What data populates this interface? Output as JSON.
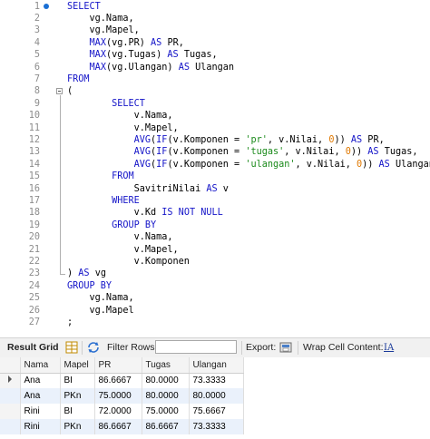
{
  "editor": {
    "lines": [
      {
        "n": "1",
        "segs": [
          [
            "kw",
            "SELECT"
          ]
        ]
      },
      {
        "n": "2",
        "segs": [
          [
            "",
            "    vg.Nama,"
          ]
        ]
      },
      {
        "n": "3",
        "segs": [
          [
            "",
            "    vg.Mapel,"
          ]
        ]
      },
      {
        "n": "4",
        "segs": [
          [
            "",
            "    "
          ],
          [
            "kw",
            "MAX"
          ],
          [
            "",
            "(vg.PR) "
          ],
          [
            "kw",
            "AS"
          ],
          [
            "",
            " PR,"
          ]
        ]
      },
      {
        "n": "5",
        "segs": [
          [
            "",
            "    "
          ],
          [
            "kw",
            "MAX"
          ],
          [
            "",
            "(vg.Tugas) "
          ],
          [
            "kw",
            "AS"
          ],
          [
            "",
            " Tugas,"
          ]
        ]
      },
      {
        "n": "6",
        "segs": [
          [
            "",
            "    "
          ],
          [
            "kw",
            "MAX"
          ],
          [
            "",
            "(vg.Ulangan) "
          ],
          [
            "kw",
            "AS"
          ],
          [
            "",
            " Ulangan"
          ]
        ]
      },
      {
        "n": "7",
        "segs": [
          [
            "kw",
            "FROM"
          ]
        ]
      },
      {
        "n": "8",
        "segs": [
          [
            "",
            "("
          ]
        ]
      },
      {
        "n": "9",
        "segs": [
          [
            "",
            "        "
          ],
          [
            "kw",
            "SELECT"
          ]
        ]
      },
      {
        "n": "10",
        "segs": [
          [
            "",
            "            v.Nama,"
          ]
        ]
      },
      {
        "n": "11",
        "segs": [
          [
            "",
            "            v.Mapel,"
          ]
        ]
      },
      {
        "n": "12",
        "segs": [
          [
            "",
            "            "
          ],
          [
            "kw",
            "AVG"
          ],
          [
            "",
            "("
          ],
          [
            "kw",
            "IF"
          ],
          [
            "",
            "(v.Komponen = "
          ],
          [
            "str",
            "'pr'"
          ],
          [
            "",
            ", v.Nilai, "
          ],
          [
            "num",
            "0"
          ],
          [
            "",
            "))"
          ],
          [
            "",
            " "
          ],
          [
            "kw",
            "AS"
          ],
          [
            "",
            " PR,"
          ]
        ]
      },
      {
        "n": "13",
        "segs": [
          [
            "",
            "            "
          ],
          [
            "kw",
            "AVG"
          ],
          [
            "",
            "("
          ],
          [
            "kw",
            "IF"
          ],
          [
            "",
            "(v.Komponen = "
          ],
          [
            "str",
            "'tugas'"
          ],
          [
            "",
            ", v.Nilai, "
          ],
          [
            "num",
            "0"
          ],
          [
            "",
            "))"
          ],
          [
            "",
            " "
          ],
          [
            "kw",
            "AS"
          ],
          [
            "",
            " Tugas,"
          ]
        ]
      },
      {
        "n": "14",
        "segs": [
          [
            "",
            "            "
          ],
          [
            "kw",
            "AVG"
          ],
          [
            "",
            "("
          ],
          [
            "kw",
            "IF"
          ],
          [
            "",
            "(v.Komponen = "
          ],
          [
            "str",
            "'ulangan'"
          ],
          [
            "",
            ", v.Nilai, "
          ],
          [
            "num",
            "0"
          ],
          [
            "",
            "))"
          ],
          [
            "",
            " "
          ],
          [
            "kw",
            "AS"
          ],
          [
            "",
            " Ulangan"
          ]
        ]
      },
      {
        "n": "15",
        "segs": [
          [
            "",
            "        "
          ],
          [
            "kw",
            "FROM"
          ]
        ]
      },
      {
        "n": "16",
        "segs": [
          [
            "",
            "            SavitriNilai "
          ],
          [
            "kw",
            "AS"
          ],
          [
            "",
            " v"
          ]
        ]
      },
      {
        "n": "17",
        "segs": [
          [
            "",
            "        "
          ],
          [
            "kw",
            "WHERE"
          ]
        ]
      },
      {
        "n": "18",
        "segs": [
          [
            "",
            "            v.Kd "
          ],
          [
            "kw",
            "IS NOT NULL"
          ]
        ]
      },
      {
        "n": "19",
        "segs": [
          [
            "",
            "        "
          ],
          [
            "kw",
            "GROUP BY"
          ]
        ]
      },
      {
        "n": "20",
        "segs": [
          [
            "",
            "            v.Nama,"
          ]
        ]
      },
      {
        "n": "21",
        "segs": [
          [
            "",
            "            v.Mapel,"
          ]
        ]
      },
      {
        "n": "22",
        "segs": [
          [
            "",
            "            v.Komponen"
          ]
        ]
      },
      {
        "n": "23",
        "segs": [
          [
            "",
            ") "
          ],
          [
            "kw",
            "AS"
          ],
          [
            "",
            " vg"
          ]
        ]
      },
      {
        "n": "24",
        "segs": [
          [
            "kw",
            "GROUP BY"
          ]
        ]
      },
      {
        "n": "25",
        "segs": [
          [
            "",
            "    vg.Nama,"
          ]
        ]
      },
      {
        "n": "26",
        "segs": [
          [
            "",
            "    vg.Mapel"
          ]
        ]
      },
      {
        "n": "27",
        "segs": [
          [
            "",
            ";"
          ]
        ]
      }
    ]
  },
  "toolbar": {
    "result_grid_label": "Result Grid",
    "filter_rows_label": "Filter Rows:",
    "filter_rows_value": "",
    "export_label": "Export:",
    "wrap_label": "Wrap Cell Content:",
    "wrap_icon_glyph": "IA"
  },
  "grid": {
    "columns": [
      "Nama",
      "Mapel",
      "PR",
      "Tugas",
      "Ulangan"
    ],
    "rows": [
      [
        "Ana",
        "BI",
        "86.6667",
        "80.0000",
        "73.3333"
      ],
      [
        "Ana",
        "PKn",
        "75.0000",
        "80.0000",
        "80.0000"
      ],
      [
        "Rini",
        "BI",
        "72.0000",
        "75.0000",
        "75.6667"
      ],
      [
        "Rini",
        "PKn",
        "86.6667",
        "86.6667",
        "73.3333"
      ]
    ]
  },
  "colors": {
    "keyword": "#1414c8",
    "string": "#1a8a1a",
    "number": "#e07800",
    "marker": "#1a6fd4",
    "alt_row": "#eaf1fb"
  },
  "icons": [
    "breakpoint-marker-icon",
    "fold-toggle-icon",
    "grid-view-icon",
    "refresh-icon",
    "filter-icon",
    "export-icon",
    "wrap-text-icon",
    "current-row-caret-icon"
  ]
}
